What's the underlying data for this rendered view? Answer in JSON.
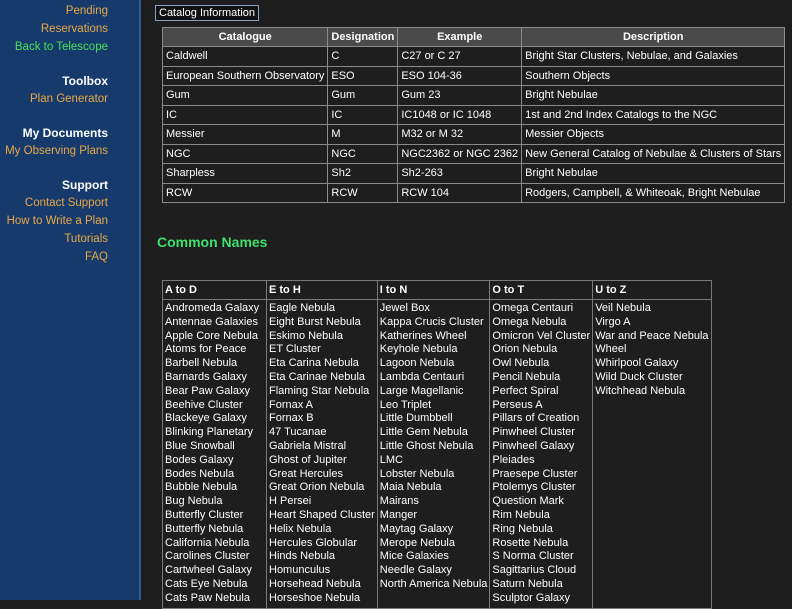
{
  "sidebar": {
    "pending_reservations": "Pending Reservations",
    "back_to_telescope": "Back to Telescope",
    "toolbox_head": "Toolbox",
    "plan_generator": "Plan Generator",
    "documents_head": "My Documents",
    "observing_plans": "My Observing Plans",
    "support_head": "Support",
    "contact_support": "Contact Support",
    "how_to_write": "How to Write a Plan",
    "tutorials": "Tutorials",
    "faq": "FAQ"
  },
  "catalog_button": "Catalog Information",
  "catalog_table": {
    "headers": [
      "Catalogue",
      "Designation",
      "Example",
      "Description"
    ],
    "rows": [
      [
        "Caldwell",
        "C",
        "C27 or C 27",
        "Bright Star Clusters, Nebulae, and Galaxies"
      ],
      [
        "European Southern Observatory",
        "ESO",
        "ESO 104-36",
        "Southern Objects"
      ],
      [
        "Gum",
        "Gum",
        "Gum 23",
        "Bright Nebulae"
      ],
      [
        "IC",
        "IC",
        "IC1048 or IC 1048",
        "1st and 2nd Index Catalogs to the NGC"
      ],
      [
        "Messier",
        "M",
        "M32 or M 32",
        "Messier Objects"
      ],
      [
        "NGC",
        "NGC",
        "NGC2362 or NGC 2362",
        "New General Catalog of Nebulae & Clusters of Stars"
      ],
      [
        "Sharpless",
        "Sh2",
        "Sh2-263",
        "Bright Nebulae"
      ],
      [
        "RCW",
        "RCW",
        "RCW 104",
        "Rodgers, Campbell, & Whiteoak, Bright Nebulae"
      ]
    ]
  },
  "common_names": {
    "title": "Common Names",
    "columns": [
      {
        "header": "A to D",
        "items": [
          "Andromeda Galaxy",
          "Antennae Galaxies",
          "Apple Core Nebula",
          "Atoms for Peace",
          "Barbell Nebula",
          "Barnards Galaxy",
          "Bear Paw Galaxy",
          "Beehive Cluster",
          "Blackeye Galaxy",
          "Blinking Planetary",
          "Blue Snowball",
          "Bodes Galaxy",
          "Bodes Nebula",
          "Bubble Nebula",
          "Bug Nebula",
          "Butterfly Cluster",
          "Butterfly Nebula",
          "California Nebula",
          "Carolines Cluster",
          "Cartwheel Galaxy",
          "Cats Eye Nebula",
          "Cats Paw Nebula"
        ]
      },
      {
        "header": "E to H",
        "items": [
          "Eagle Nebula",
          "Eight Burst Nebula",
          "Eskimo Nebula",
          "ET Cluster",
          "Eta Carina Nebula",
          "Eta Carinae Nebula",
          "Flaming Star Nebula",
          "Fornax A",
          "Fornax B",
          "47 Tucanae",
          "Gabriela Mistral",
          "Ghost of Jupiter",
          "Great Hercules",
          "Great Orion Nebula",
          "H Persei",
          "Heart Shaped Cluster",
          "Helix Nebula",
          "Hercules Globular",
          "Hinds Nebula",
          "Homunculus",
          "Horsehead Nebula",
          "Horseshoe Nebula"
        ]
      },
      {
        "header": "I to N",
        "items": [
          "Jewel Box",
          "Kappa Crucis Cluster",
          "Katherines Wheel",
          "Keyhole Nebula",
          "Lagoon Nebula",
          "Lambda Centauri",
          "Large Magellanic",
          "Leo Triplet",
          "Little Dumbbell",
          "Little Gem Nebula",
          "Little Ghost Nebula",
          "LMC",
          "Lobster Nebula",
          "Maia Nebula",
          "Mairans",
          "Manger",
          "Maytag Galaxy",
          "Merope Nebula",
          "Mice Galaxies",
          "Needle Galaxy",
          "North America Nebula"
        ]
      },
      {
        "header": "O to T",
        "items": [
          "Omega Centauri",
          "Omega Nebula",
          "Omicron Vel Cluster",
          "Orion Nebula",
          "Owl Nebula",
          "Pencil Nebula",
          "Perfect Spiral",
          "Perseus A",
          "Pillars of Creation",
          "Pinwheel Cluster",
          "Pinwheel Galaxy",
          "Pleiades",
          "Praesepe Cluster",
          "Ptolemys Cluster",
          "Question Mark",
          "Rim Nebula",
          "Ring Nebula",
          "Rosette Nebula",
          "S Norma Cluster",
          "Sagittarius Cloud",
          "Saturn Nebula",
          "Sculptor Galaxy"
        ]
      },
      {
        "header": "U to Z",
        "items": [
          "Veil Nebula",
          "Virgo A",
          "War and Peace Nebula",
          "Wheel",
          "Whirlpool Galaxy",
          "Wild Duck Cluster",
          "Witchhead Nebula"
        ]
      }
    ]
  }
}
